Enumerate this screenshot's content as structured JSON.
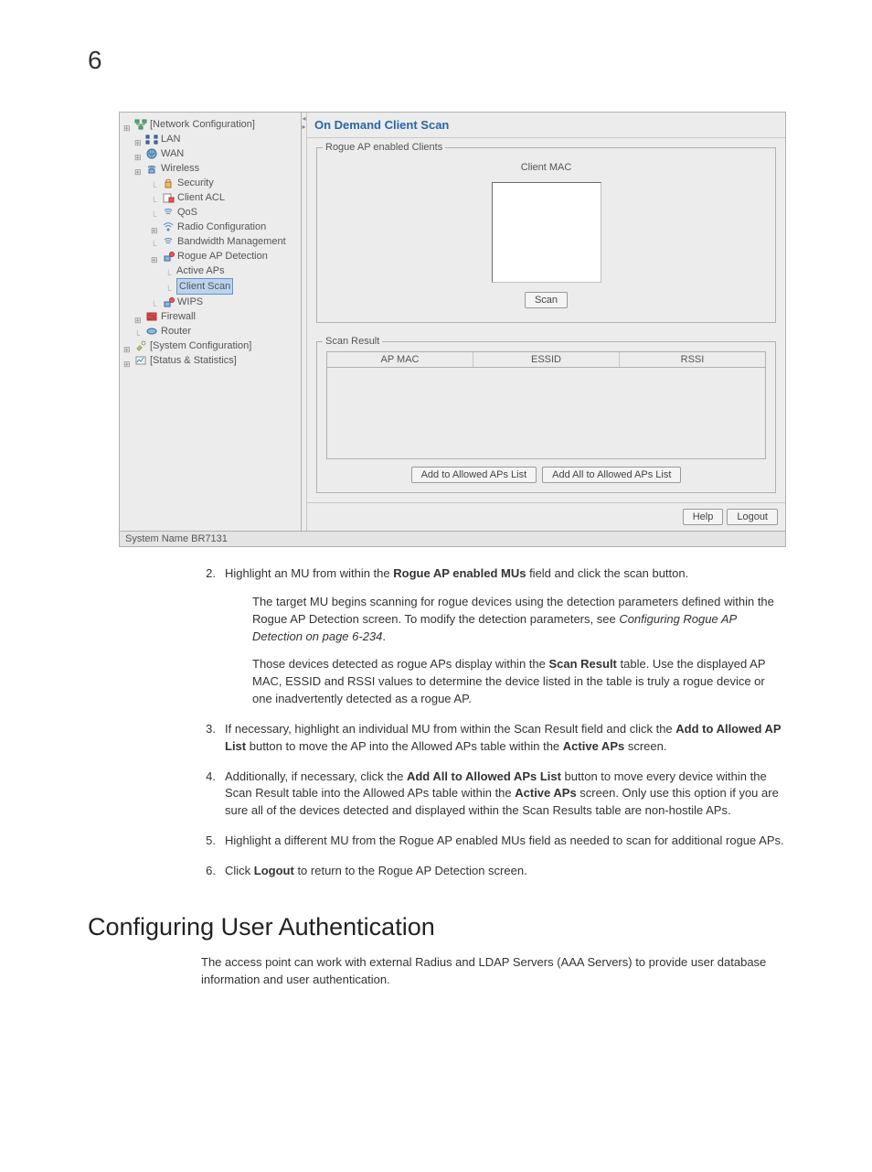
{
  "pageNumber": "6",
  "screenshot": {
    "tree": {
      "networkConfig": "[Network Configuration]",
      "lan": "LAN",
      "wan": "WAN",
      "wireless": "Wireless",
      "security": "Security",
      "clientAcl": "Client ACL",
      "qos": "QoS",
      "radioConfig": "Radio Configuration",
      "bandwidth": "Bandwidth Management",
      "rogueAp": "Rogue AP Detection",
      "activeAps": "Active APs",
      "clientScan": "Client Scan",
      "wips": "WIPS",
      "firewall": "Firewall",
      "router": "Router",
      "sysConfig": "[System Configuration]",
      "status": "[Status & Statistics]"
    },
    "mainTitle": "On Demand Client Scan",
    "rogueLegend": "Rogue AP enabled Clients",
    "clientMacLabel": "Client MAC",
    "scanBtn": "Scan",
    "scanResultLegend": "Scan Result",
    "th": {
      "apmac": "AP MAC",
      "essid": "ESSID",
      "rssi": "RSSI"
    },
    "addAllowed": "Add to Allowed APs List",
    "addAllAllowed": "Add All to Allowed APs List",
    "helpBtn": "Help",
    "logoutBtn": "Logout",
    "systemName": "System Name BR7131"
  },
  "steps": {
    "s2": {
      "num": "2.",
      "a": "Highlight an MU from within the ",
      "b": "Rogue AP enabled MUs",
      "c": " field and click the scan button.",
      "p1": "The target MU begins scanning for rogue devices using the detection parameters defined within the Rogue AP Detection screen. To modify the detection parameters, see ",
      "p1i": "Configuring Rogue AP Detection on page 6-234",
      "p1e": ".",
      "p2a": "Those devices detected as rogue APs display within the ",
      "p2b": "Scan Result",
      "p2c": " table. Use the displayed AP MAC, ESSID and RSSI values to determine the device listed in the table is truly a rogue device or one inadvertently detected as a rogue AP."
    },
    "s3": {
      "num": "3.",
      "a": "If necessary, highlight an individual MU from within the Scan Result field and click the ",
      "b": "Add to Allowed AP List",
      "c": " button to move the AP into the Allowed APs table within the ",
      "d": "Active APs",
      "e": " screen."
    },
    "s4": {
      "num": "4.",
      "a": "Additionally, if necessary, click the ",
      "b": "Add All to Allowed APs List",
      "c": " button to move every device within the Scan Result table into the Allowed APs table within the ",
      "d": "Active APs",
      "e": " screen. Only use this option if you are sure all of the devices detected and displayed within the Scan Results table are non-hostile APs."
    },
    "s5": {
      "num": "5.",
      "a": "Highlight a different MU from the Rogue AP enabled MUs field as needed to scan for additional rogue APs."
    },
    "s6": {
      "num": "6.",
      "a": "Click ",
      "b": "Logout",
      "c": " to return to the Rogue AP Detection screen."
    }
  },
  "sectionHeading": "Configuring User Authentication",
  "sectionPara": "The access point can work with external Radius and LDAP Servers (AAA Servers) to provide user database information and user authentication."
}
